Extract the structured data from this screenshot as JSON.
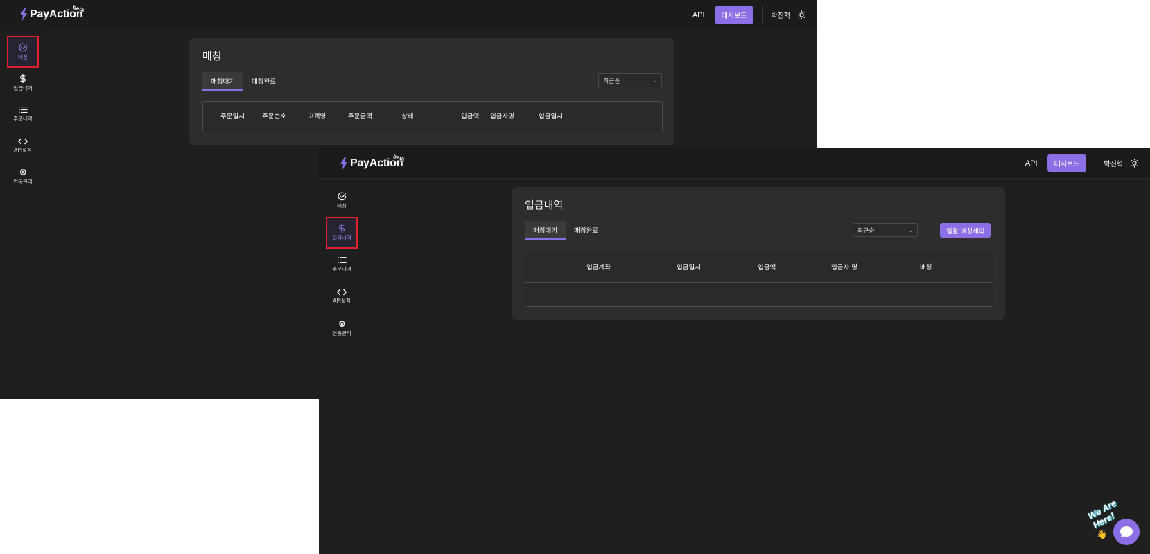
{
  "brand": {
    "name": "PayAction",
    "badge": "beta"
  },
  "header": {
    "api_label": "API",
    "dashboard_label": "대시보드",
    "user_name": "박진혁"
  },
  "sidebar": {
    "items": [
      {
        "label": "매칭",
        "icon": "check-circle-icon"
      },
      {
        "label": "입금내역",
        "icon": "dollar-icon"
      },
      {
        "label": "주문내역",
        "icon": "list-icon"
      },
      {
        "label": "API설정",
        "icon": "code-icon"
      },
      {
        "label": "연동관리",
        "icon": "gear-icon"
      }
    ]
  },
  "window1": {
    "title": "매칭",
    "tabs": [
      "매칭대기",
      "매칭완료"
    ],
    "sort_value": "최근순",
    "columns": [
      "주문일시",
      "주문번호",
      "고객명",
      "주문금액",
      "상태",
      "입금액",
      "입금자명",
      "입금일시"
    ]
  },
  "window2": {
    "title": "입금내역",
    "tabs": [
      "매칭대기",
      "매칭완료"
    ],
    "sort_value": "최근순",
    "exclude_button": "일괄 매칭제외",
    "columns": [
      "입금계좌",
      "입금일시",
      "입금액",
      "입금자 명",
      "매칭"
    ]
  },
  "chat_widget": {
    "text": "We Are Here!",
    "emoji": "👋"
  },
  "colors": {
    "accent": "#8b6fe6",
    "highlight_border": "#e0202a",
    "background": "#1f1f1f",
    "card": "#2d2d2d"
  }
}
